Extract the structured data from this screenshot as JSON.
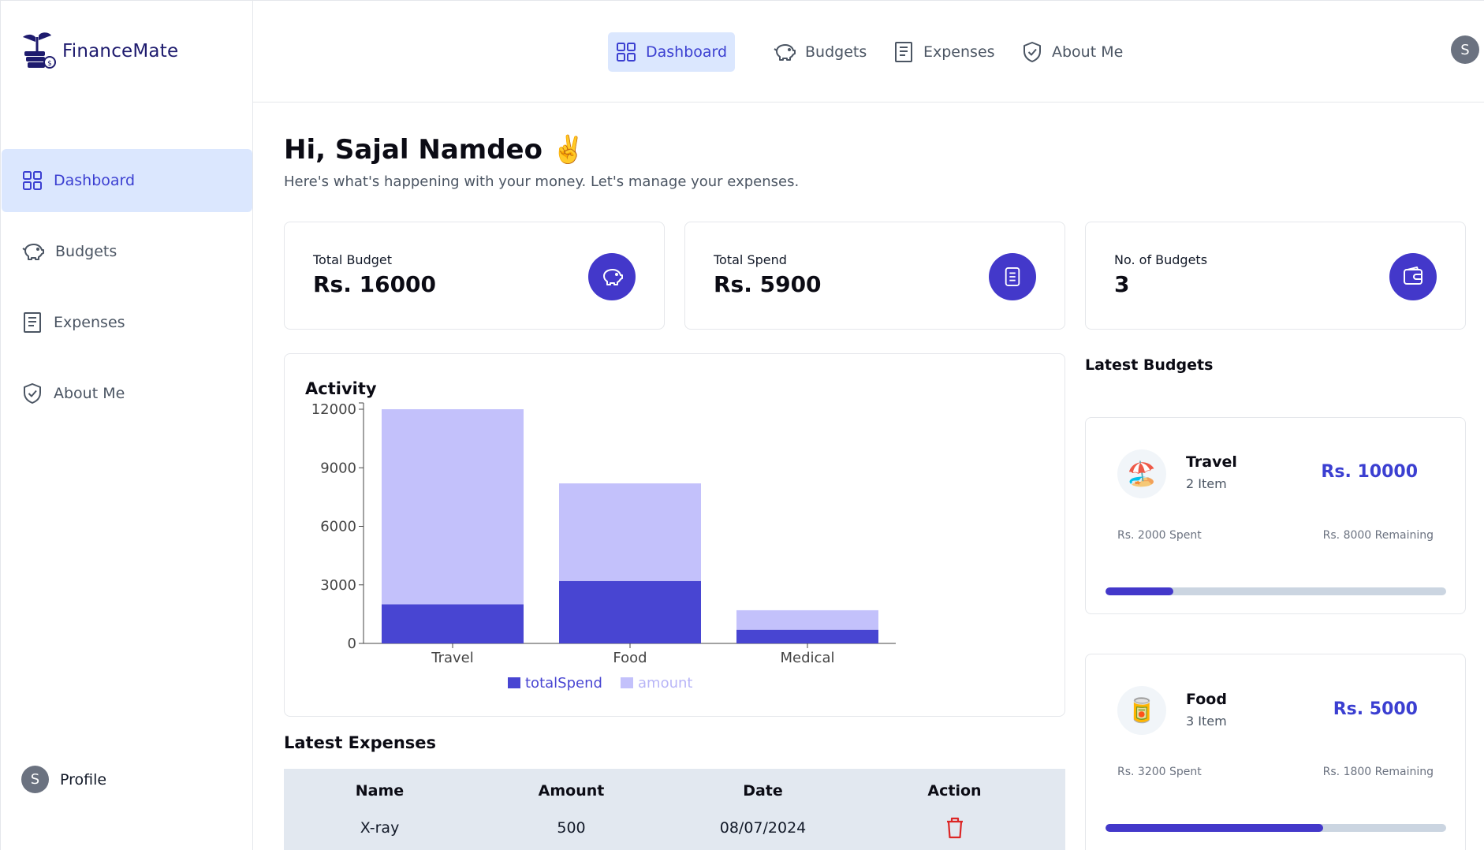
{
  "app": {
    "name": "FinanceMate"
  },
  "sidebar": {
    "items": [
      {
        "label": "Dashboard",
        "icon": "dashboard-grid-icon",
        "active": true
      },
      {
        "label": "Budgets",
        "icon": "piggy-bank-icon",
        "active": false
      },
      {
        "label": "Expenses",
        "icon": "receipt-icon",
        "active": false
      },
      {
        "label": "About Me",
        "icon": "shield-check-icon",
        "active": false
      }
    ],
    "profile": {
      "label": "Profile",
      "initial": "S"
    }
  },
  "topnav": {
    "items": [
      {
        "label": "Dashboard",
        "icon": "dashboard-grid-icon",
        "active": true
      },
      {
        "label": "Budgets",
        "icon": "piggy-bank-icon",
        "active": false
      },
      {
        "label": "Expenses",
        "icon": "receipt-icon",
        "active": false
      },
      {
        "label": "About Me",
        "icon": "shield-check-icon",
        "active": false
      }
    ],
    "avatar_initial": "S"
  },
  "greeting": {
    "title": "Hi, Sajal Namdeo ✌️",
    "subtitle": "Here's what's happening with your money. Let's manage your expenses."
  },
  "stats": [
    {
      "label": "Total Budget",
      "value": "Rs. 16000",
      "icon": "piggy-bank-icon"
    },
    {
      "label": "Total Spend",
      "value": "Rs. 5900",
      "icon": "receipt-icon"
    },
    {
      "label": "No. of Budgets",
      "value": "3",
      "icon": "wallet-icon"
    }
  ],
  "activity": {
    "title": "Activity"
  },
  "chart_data": {
    "type": "bar",
    "stacked": true,
    "title": "Activity",
    "categories": [
      "Travel",
      "Food",
      "Medical"
    ],
    "series": [
      {
        "name": "totalSpend",
        "values": [
          2000,
          3200,
          700
        ],
        "color": "#4845d2"
      },
      {
        "name": "amount",
        "values": [
          10000,
          5000,
          1000
        ],
        "color": "#c3c1fb"
      }
    ],
    "yticks": [
      "0",
      "3000",
      "6000",
      "9000",
      "12000"
    ],
    "ylim": [
      0,
      12000
    ],
    "legend": "bottom",
    "grid": false
  },
  "latest_expenses": {
    "title": "Latest Expenses",
    "columns": [
      "Name",
      "Amount",
      "Date",
      "Action"
    ],
    "rows": [
      {
        "name": "X-ray",
        "amount": "500",
        "date": "08/07/2024",
        "action_icon": "trash-icon"
      }
    ]
  },
  "latest_budgets": {
    "title": "Latest Budgets",
    "items": [
      {
        "emoji": "🏖️",
        "name": "Travel",
        "items": "2 Item",
        "amount": "Rs. 10000",
        "spent": "Rs. 2000 Spent",
        "remaining": "Rs. 8000 Remaining",
        "progress": 0.2
      },
      {
        "emoji": "🥫",
        "name": "Food",
        "items": "3 Item",
        "amount": "Rs. 5000",
        "spent": "Rs. 3200 Spent",
        "remaining": "Rs. 1800 Remaining",
        "progress": 0.64
      }
    ]
  },
  "colors": {
    "accent": "#4338ca",
    "accent_light": "#dbe7fe",
    "danger": "#dc2626"
  }
}
